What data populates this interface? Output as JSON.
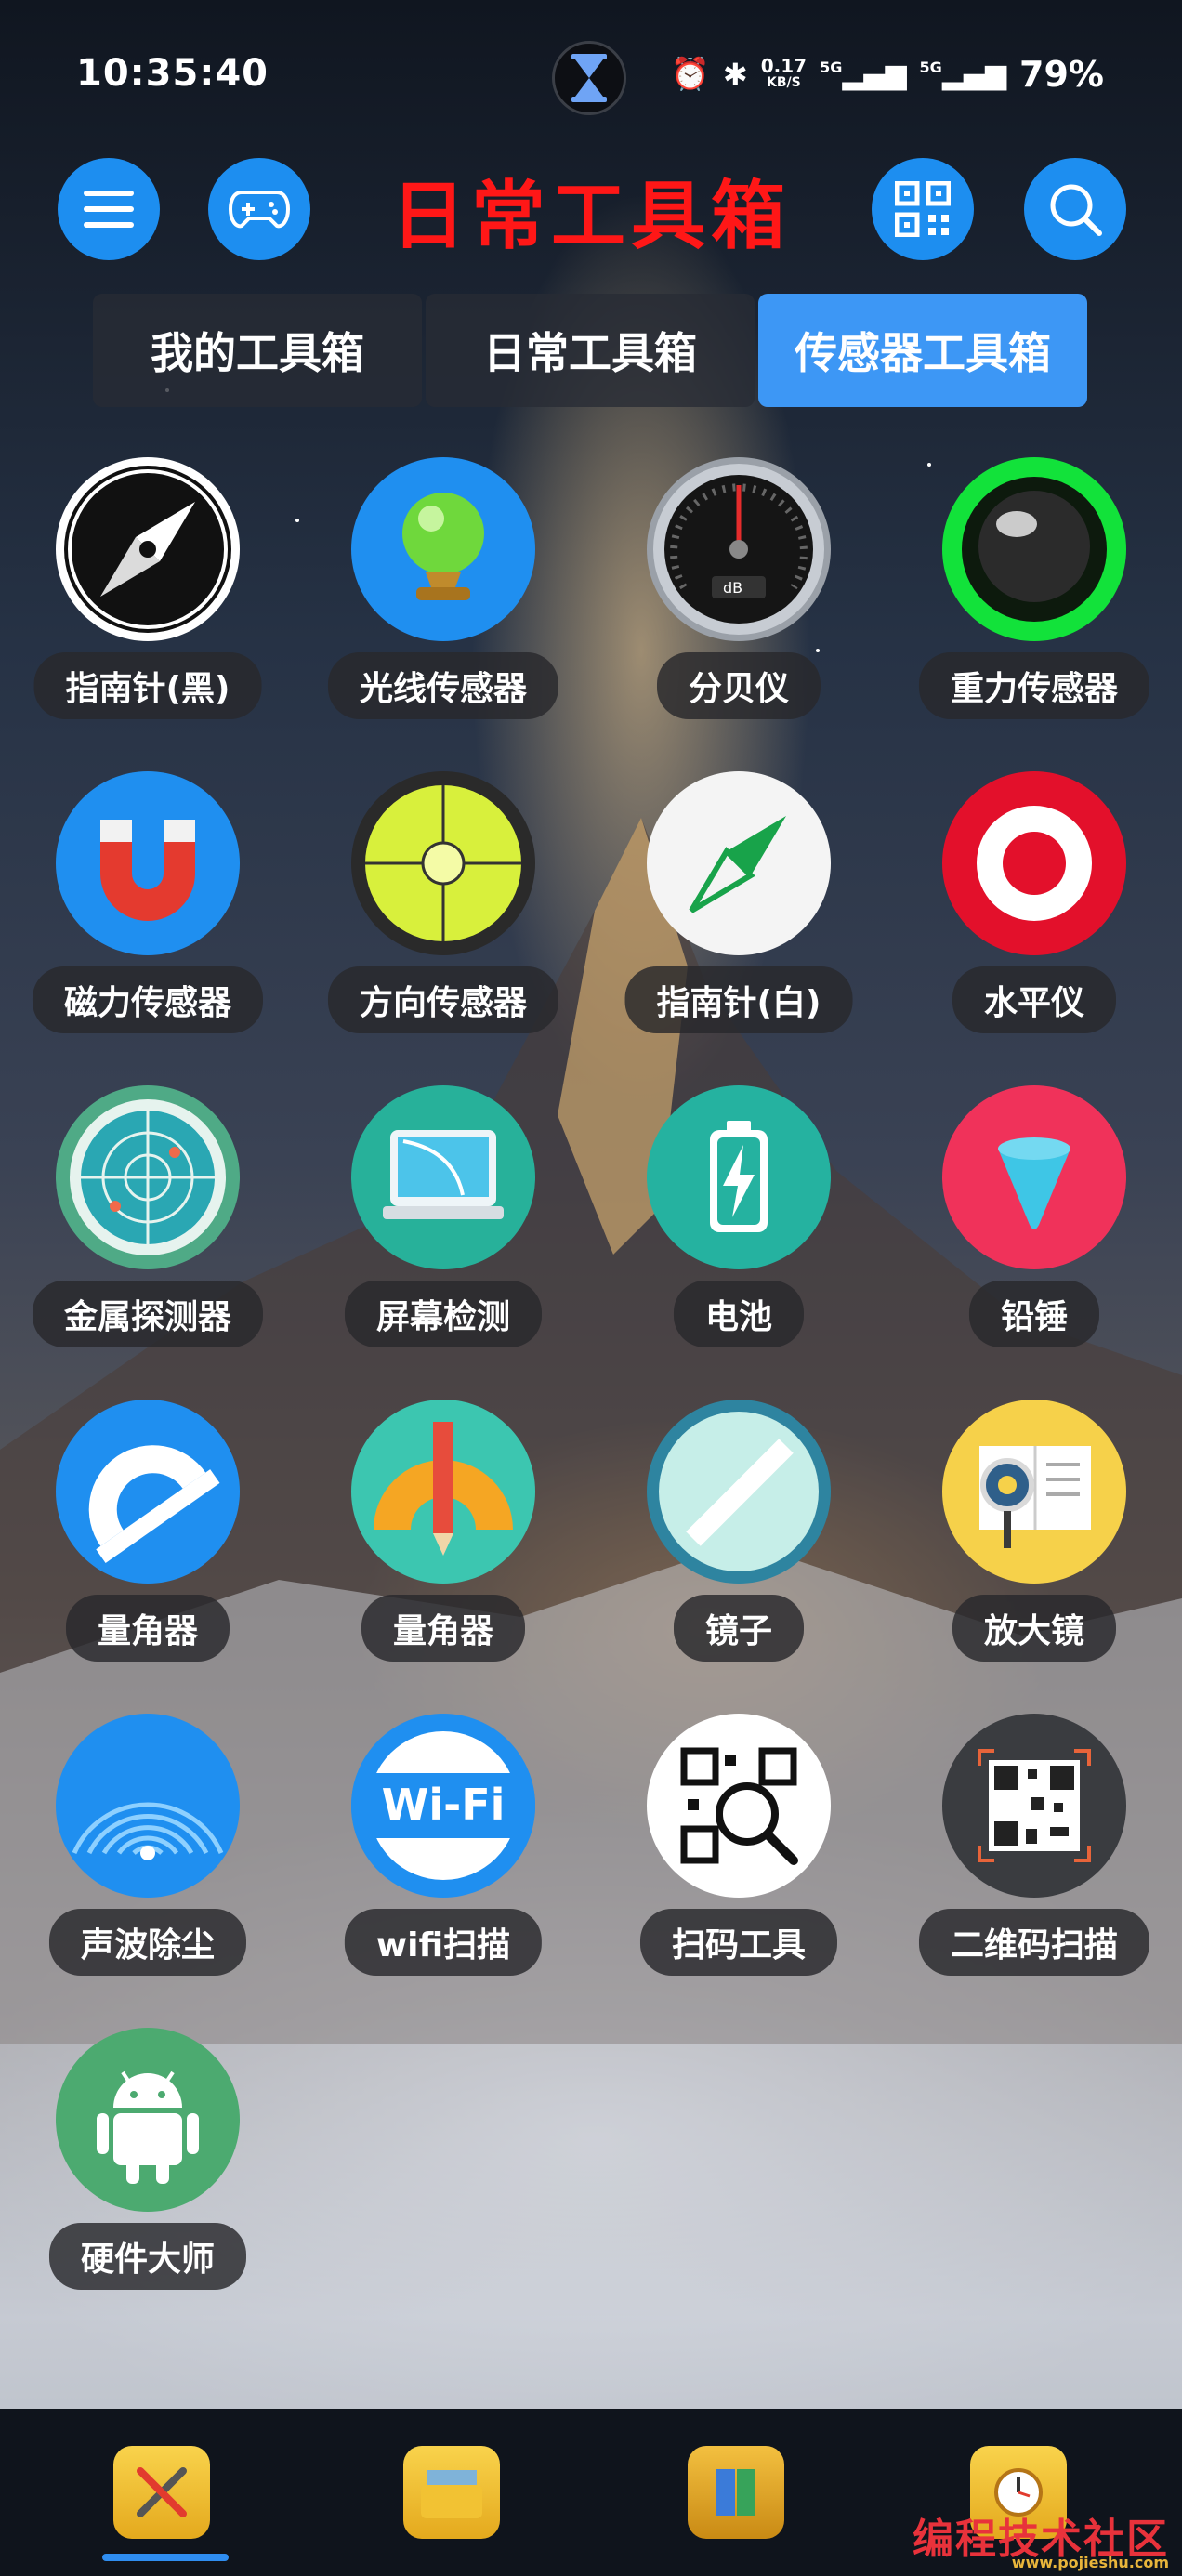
{
  "status_bar": {
    "time": "10:35:40",
    "speed_value": "0.17",
    "speed_unit": "KB/S",
    "network_1": "5G",
    "network_2": "5G",
    "battery": "79%"
  },
  "header": {
    "title": "日常工具箱",
    "menu_icon": "menu-icon",
    "game_icon": "gamepad-icon",
    "qr_icon": "qr-code-icon",
    "search_icon": "search-icon"
  },
  "tabs": [
    {
      "label": "我的工具箱",
      "active": false
    },
    {
      "label": "日常工具箱",
      "active": false
    },
    {
      "label": "传感器工具箱",
      "active": true
    }
  ],
  "tools": [
    {
      "label": "指南针(黑)",
      "icon": "compass-black-icon"
    },
    {
      "label": "光线传感器",
      "icon": "crystal-ball-icon"
    },
    {
      "label": "分贝仪",
      "icon": "decibel-gauge-icon",
      "gauge_text": "dB"
    },
    {
      "label": "重力传感器",
      "icon": "gravity-ball-icon"
    },
    {
      "label": "磁力传感器",
      "icon": "magnet-icon"
    },
    {
      "label": "方向传感器",
      "icon": "crosshair-level-icon"
    },
    {
      "label": "指南针(白)",
      "icon": "compass-white-icon"
    },
    {
      "label": "水平仪",
      "icon": "target-level-icon"
    },
    {
      "label": "金属探测器",
      "icon": "radar-icon"
    },
    {
      "label": "屏幕检测",
      "icon": "monitor-icon"
    },
    {
      "label": "电池",
      "icon": "battery-icon"
    },
    {
      "label": "铅锤",
      "icon": "plumb-bob-icon"
    },
    {
      "label": "量角器",
      "icon": "protractor-icon"
    },
    {
      "label": "量角器",
      "icon": "protractor-pencil-icon"
    },
    {
      "label": "镜子",
      "icon": "mirror-icon"
    },
    {
      "label": "放大镜",
      "icon": "magnifier-book-icon"
    },
    {
      "label": "声波除尘",
      "icon": "sound-wave-icon"
    },
    {
      "label": "wifi扫描",
      "icon": "wifi-icon",
      "icon_text": "Wi-Fi"
    },
    {
      "label": "扫码工具",
      "icon": "scan-qr-icon"
    },
    {
      "label": "二维码扫描",
      "icon": "qr-scan-icon"
    },
    {
      "label": "硬件大师",
      "icon": "android-icon"
    }
  ],
  "dock": {
    "items": [
      "tools-folder-icon",
      "photos-folder-icon",
      "apps-folder-icon",
      "clock-folder-icon"
    ]
  },
  "watermark": {
    "text": "编程技术社区",
    "url": "www.pojieshu.com"
  },
  "colors": {
    "accent": "#1d8ef0",
    "title_red": "#ff1717",
    "active_tab": "#3d97f5"
  }
}
